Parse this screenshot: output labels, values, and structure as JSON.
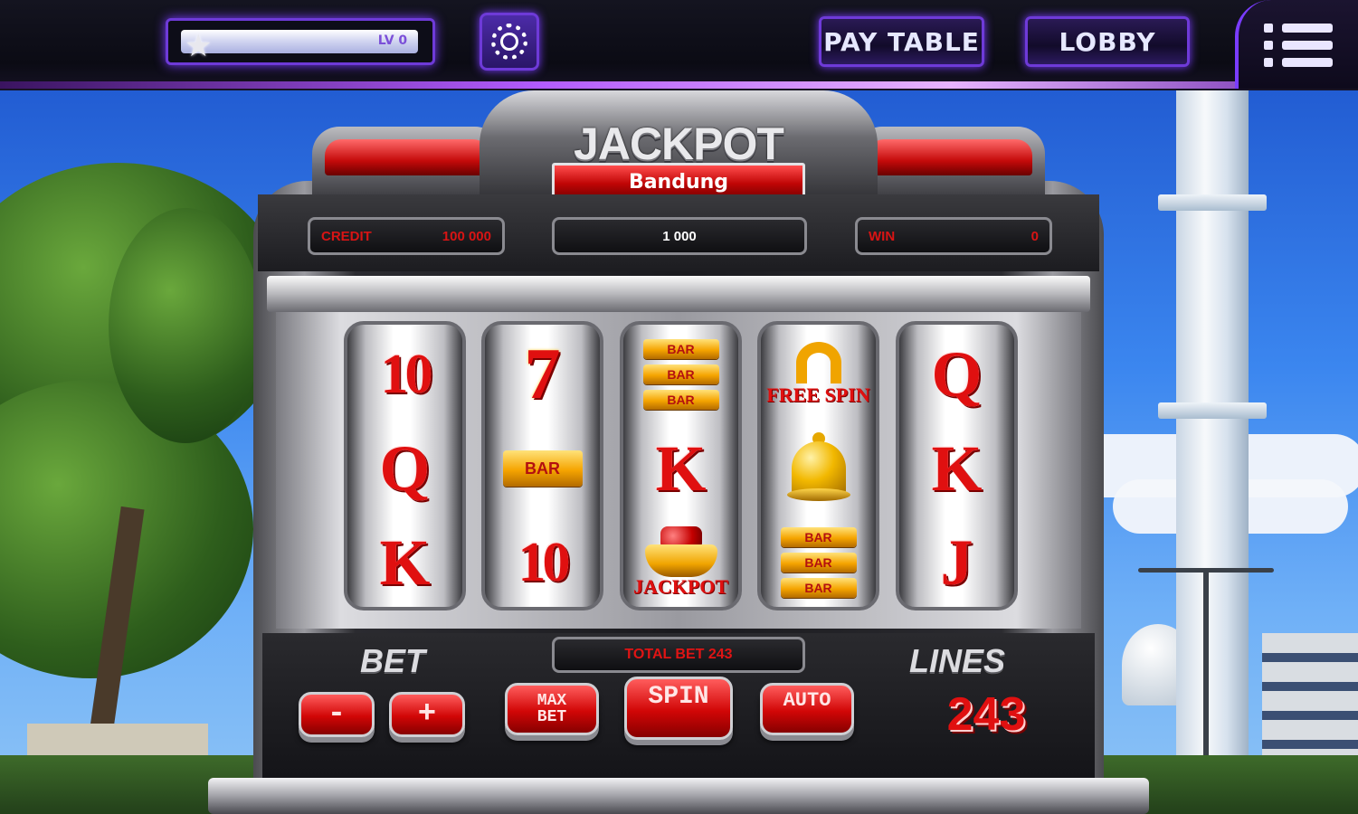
{
  "topbar": {
    "level_label": "LV 0",
    "xp_fraction": 0.95,
    "paytable_label": "PAY TABLE",
    "lobby_label": "LOBBY"
  },
  "machine": {
    "title": "JACKPOT",
    "city": "Bandung",
    "credit_label": "CREDIT",
    "credit_value": "100 000",
    "jackpot_value": "1 000",
    "win_label": "WIN",
    "win_value": "0",
    "total_bet": "TOTAL BET 243",
    "bet_label": "BET",
    "lines_label": "LINES",
    "lines_value": "243"
  },
  "reels": [
    [
      "10",
      "Q",
      "K"
    ],
    [
      "7",
      "BAR",
      "10"
    ],
    [
      "BAR-BAR-BAR",
      "K",
      "JACKPOT"
    ],
    [
      "FREE SPIN",
      "BELL",
      "BAR-BAR-BAR"
    ],
    [
      "Q",
      "K",
      "J"
    ]
  ],
  "reel_symbol_text": {
    "bar": "BAR",
    "free_spin": "FREE SPIN",
    "jackpot": "JACKPOT"
  },
  "controls": {
    "minus_label": "-",
    "plus_label": "+",
    "maxbet_label_1": "MAX",
    "maxbet_label_2": "BET",
    "spin_label": "SPIN",
    "auto_label": "AUTO"
  },
  "colors": {
    "accent_purple": "#7a3cff",
    "machine_red": "#e01010",
    "bar_gold": "#f5a400"
  },
  "icons": {
    "xp": "star-icon",
    "settings": "gear-icon",
    "menu": "menu-icon"
  }
}
